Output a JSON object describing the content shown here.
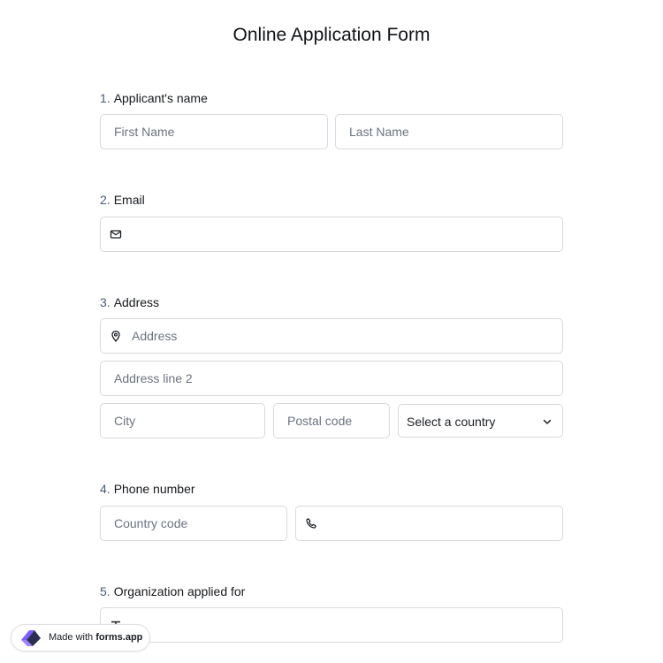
{
  "form": {
    "title": "Online Application Form"
  },
  "questions": [
    {
      "number": "1.",
      "label": "Applicant's name",
      "fields": [
        {
          "placeholder": "First Name"
        },
        {
          "placeholder": "Last Name"
        }
      ]
    },
    {
      "number": "2.",
      "label": "Email",
      "fields": [
        {
          "placeholder": "",
          "icon": "envelope-icon"
        }
      ]
    },
    {
      "number": "3.",
      "label": "Address",
      "fields": [
        {
          "placeholder": "Address",
          "icon": "map-pin-icon"
        },
        {
          "placeholder": "Address line 2"
        },
        {
          "placeholder": "City"
        },
        {
          "placeholder": "Postal code"
        },
        {
          "value": "Select a country",
          "icon": "chevron-down-icon"
        }
      ]
    },
    {
      "number": "4.",
      "label": "Phone number",
      "fields": [
        {
          "placeholder": "Country code"
        },
        {
          "placeholder": "",
          "icon": "phone-icon"
        }
      ]
    },
    {
      "number": "5.",
      "label": "Organization applied for",
      "fields": [
        {
          "placeholder": "",
          "icon": "text-icon"
        }
      ]
    }
  ],
  "badge": {
    "prefix": "Made with",
    "brand": "forms.app",
    "icon": "forms-app-logo-icon",
    "colors": {
      "logo_primary": "#7b5cff",
      "logo_dark": "#2a2f52"
    }
  }
}
